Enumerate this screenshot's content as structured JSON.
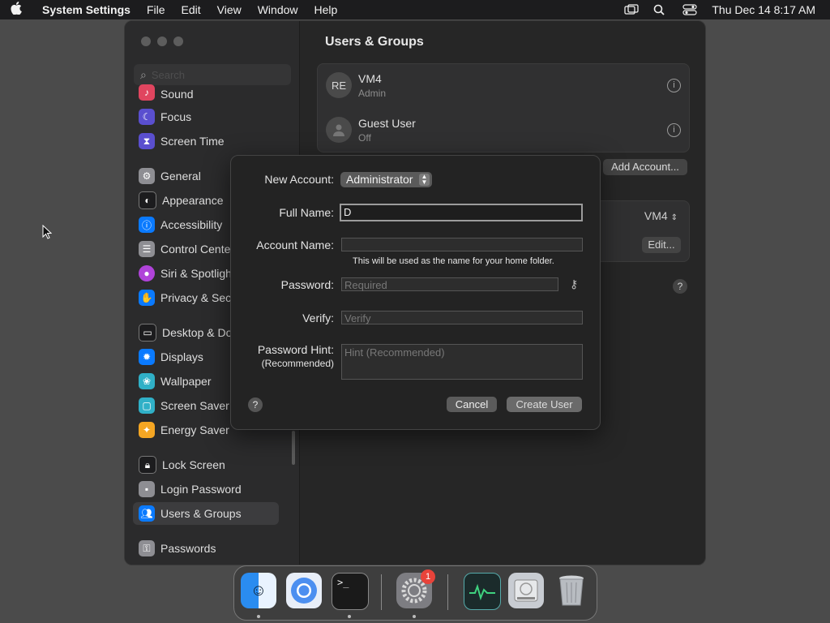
{
  "menubar": {
    "app_name": "System Settings",
    "menus": [
      "File",
      "Edit",
      "View",
      "Window",
      "Help"
    ],
    "clock": "Thu Dec 14  8:17 AM"
  },
  "sidebar": {
    "search_placeholder": "Search",
    "items": [
      {
        "label": "Sound",
        "icon": "speaker-icon",
        "color": "#e0455f"
      },
      {
        "label": "Focus",
        "icon": "moon-icon",
        "color": "#5a4fcf"
      },
      {
        "label": "Screen Time",
        "icon": "hourglass-icon",
        "color": "#5a4fcf"
      },
      {
        "label": "General",
        "icon": "gear-icon",
        "color": "#8e8e93"
      },
      {
        "label": "Appearance",
        "icon": "appearance-icon",
        "color": "#1c1c1e"
      },
      {
        "label": "Accessibility",
        "icon": "accessibility-icon",
        "color": "#0a7aff"
      },
      {
        "label": "Control Center",
        "icon": "control-center-icon",
        "color": "#8e8e93"
      },
      {
        "label": "Siri & Spotlight",
        "icon": "siri-icon",
        "color": "#b043d9"
      },
      {
        "label": "Privacy & Security",
        "icon": "hand-icon",
        "color": "#0a7aff"
      },
      {
        "label": "Desktop & Dock",
        "icon": "dock-icon",
        "color": "#1c1c1e"
      },
      {
        "label": "Displays",
        "icon": "sun-icon",
        "color": "#0a7aff"
      },
      {
        "label": "Wallpaper",
        "icon": "wallpaper-icon",
        "color": "#30b0c7"
      },
      {
        "label": "Screen Saver",
        "icon": "screen-saver-icon",
        "color": "#30b0c7"
      },
      {
        "label": "Energy Saver",
        "icon": "bulb-icon",
        "color": "#f5a623"
      },
      {
        "label": "Lock Screen",
        "icon": "lock-icon",
        "color": "#1c1c1e"
      },
      {
        "label": "Login Password",
        "icon": "login-password-icon",
        "color": "#8e8e93"
      },
      {
        "label": "Users & Groups",
        "icon": "users-icon",
        "color": "#0a7aff"
      },
      {
        "label": "Passwords",
        "icon": "key-icon",
        "color": "#8e8e93"
      }
    ]
  },
  "content": {
    "title": "Users & Groups",
    "users": [
      {
        "avatar": "RE",
        "name": "VM4",
        "role": "Admin"
      },
      {
        "avatar": "",
        "name": "Guest User",
        "role": "Off"
      }
    ],
    "add_account": "Add Account...",
    "auto_login_value": "VM4",
    "edit": "Edit...",
    "help": "?"
  },
  "sheet": {
    "new_account_label": "New Account:",
    "account_type": "Administrator",
    "full_name_label": "Full Name:",
    "full_name_value": "D",
    "account_name_label": "Account Name:",
    "account_name_value": "",
    "account_name_note": "This will be used as the name for your home folder.",
    "password_label": "Password:",
    "password_placeholder": "Required",
    "verify_label": "Verify:",
    "verify_placeholder": "Verify",
    "hint_label": "Password Hint:",
    "hint_sublabel": "(Recommended)",
    "hint_placeholder": "Hint (Recommended)",
    "help": "?",
    "cancel": "Cancel",
    "create": "Create User"
  },
  "dock": {
    "apps": [
      "Finder",
      "Chromium",
      "Terminal",
      "System Settings",
      "Activity Monitor",
      "Disk Utility",
      "Trash"
    ],
    "settings_badge": "1"
  }
}
